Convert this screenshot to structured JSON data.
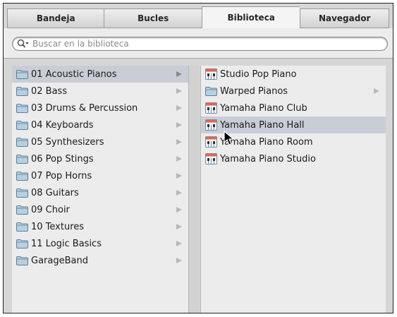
{
  "tabs": [
    {
      "label": "Bandeja",
      "active": false
    },
    {
      "label": "Bucles",
      "active": false
    },
    {
      "label": "Biblioteca",
      "active": true
    },
    {
      "label": "Navegador",
      "active": false
    }
  ],
  "search": {
    "placeholder": "Buscar en la biblioteca",
    "icon": "magnifier-dropdown-icon"
  },
  "categories": [
    {
      "label": "01 Acoustic Pianos",
      "selected": true
    },
    {
      "label": "02 Bass"
    },
    {
      "label": "03 Drums & Percussion"
    },
    {
      "label": "04 Keyboards"
    },
    {
      "label": "05 Synthesizers"
    },
    {
      "label": "06 Pop Stings"
    },
    {
      "label": "07 Pop Horns"
    },
    {
      "label": "08 Guitars"
    },
    {
      "label": "09 Choir"
    },
    {
      "label": "10 Textures"
    },
    {
      "label": "11 Logic Basics"
    },
    {
      "label": "GarageBand"
    }
  ],
  "patches": [
    {
      "label": "Studio Pop Piano",
      "type": "patch"
    },
    {
      "label": "Warped Pianos",
      "type": "folder",
      "has_submenu": true
    },
    {
      "label": "Yamaha Piano Club",
      "type": "patch"
    },
    {
      "label": "Yamaha Piano Hall",
      "type": "patch",
      "selected": true
    },
    {
      "label": "Yamaha Piano Room",
      "type": "patch"
    },
    {
      "label": "Yamaha Piano Studio",
      "type": "patch"
    }
  ],
  "colors": {
    "selection": "#c9cdd6",
    "folder_fill": "#b7cfe0",
    "folder_stroke": "#5d7f97"
  }
}
